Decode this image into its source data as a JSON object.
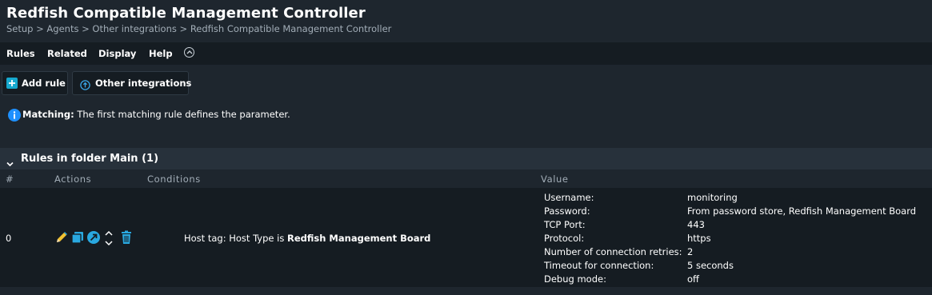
{
  "page": {
    "title": "Redfish Compatible Management Controller",
    "breadcrumb": "Setup > Agents > Other integrations > Redfish Compatible Management Controller"
  },
  "menu": {
    "items": [
      "Rules",
      "Related",
      "Display",
      "Help"
    ]
  },
  "toolbar": {
    "add_rule": "Add rule",
    "other_integrations": "Other integrations"
  },
  "info": {
    "bold": "Matching:",
    "text": " The first matching rule defines the parameter."
  },
  "section": {
    "title": "Rules in folder Main (1)"
  },
  "columns": {
    "num": "#",
    "actions": "Actions",
    "conditions": "Conditions",
    "value": "Value"
  },
  "rule": {
    "number": "0",
    "condition_prefix": "Host tag: Host Type is ",
    "condition_value": "Redfish Management Board",
    "values": [
      {
        "key": "Username:",
        "val": "monitoring"
      },
      {
        "key": "Password:",
        "val": "From password store, Redfish Management Board"
      },
      {
        "key": "TCP Port:",
        "val": "443"
      },
      {
        "key": "Protocol:",
        "val": "https"
      },
      {
        "key": "Number of connection retries:",
        "val": "2"
      },
      {
        "key": "Timeout for connection:",
        "val": "5 seconds"
      },
      {
        "key": "Debug mode:",
        "val": "off"
      }
    ]
  },
  "colors": {
    "accent_blue": "#1e90ff",
    "add_green": "#16a8ce",
    "icon_blue": "#29a8e0"
  },
  "icons": [
    "plus-icon",
    "arrow-up-circle-icon",
    "info-icon",
    "chevron-down-icon",
    "pencil-icon",
    "copy-icon",
    "export-icon",
    "move-icon",
    "trash-icon",
    "collapse-icon"
  ]
}
